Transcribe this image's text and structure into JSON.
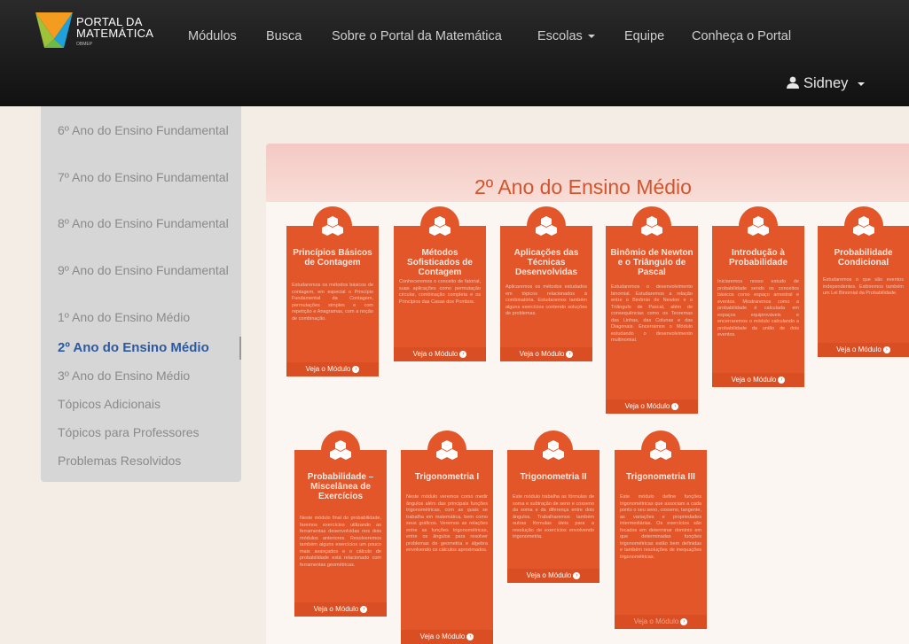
{
  "navbar": {
    "logo_line1": "PORTAL DA",
    "logo_line2": "MATEMÁTICA",
    "logo_sub": "OBMEP",
    "links": [
      "Módulos",
      "Busca",
      "Sobre o Portal da Matemática",
      "Escolas",
      "Equipe",
      "Conheça o Portal"
    ],
    "user": "Sidney"
  },
  "sidebar": {
    "items": [
      "6º Ano do Ensino Fundamental",
      "7º Ano do Ensino Fundamental",
      "8º Ano do Ensino Fundamental",
      "9º Ano do Ensino Fundamental",
      "1º Ano do Ensino Médio",
      "2º Ano do Ensino Médio",
      "3º Ano do Ensino Médio",
      "Tópicos Adicionais",
      "Tópicos para Professores",
      "Problemas Resolvidos"
    ],
    "active_index": 5
  },
  "main": {
    "heading": "2º Ano do Ensino Médio",
    "button_label": "Veja o Módulo",
    "cards": [
      {
        "title": "Princípios Básicos de Contagem",
        "desc": "Estudaremos os métodos básicos de contagem, em especial o Princípio Fundamental da Contagem, permutações simples e com repetição e Anagramas, com a noção de combinação."
      },
      {
        "title": "Métodos Sofisticados de Contagem",
        "desc": "Conheceremos o conceito de fatorial, suas aplicações como permutação circular, combinação completa e os Princípios das Casas dos Pombos."
      },
      {
        "title": "Aplicações das Técnicas Desenvolvidas",
        "desc": "Aplicaremos os métodos estudados em tópicos relacionados à combinatória. Estudaremos também alguns exercícios contendo soluções de problemas."
      },
      {
        "title": "Binômio de Newton e o Triângulo de Pascal",
        "desc": "Estudaremos o desenvolvimento binomial. Estudaremos a relação entre o Binômio de Newton e o Triângulo de Pascal, além de consequências como os Teoremas das Linhas, das Colunas e das Diagonais. Encerramos o Módulo estudando o desenvolvimento multinomial."
      },
      {
        "title": "Introdução à Probabilidade",
        "desc": "Iniciaremos nosso estudo de probabilidade sendo os conceitos básicos como espaço amostral e eventos. Mostraremos como a probabilidade é calculada em espaços equiprováveis e encerraremos o módulo calculando a probabilidade da união de dois eventos."
      },
      {
        "title": "Probabilidade Condicional",
        "desc": "Estudaremos o que são eventos independentes. Exibiremos também um Lei Binomial da Probabilidade."
      },
      {
        "title": "Probabilidade – Miscelânea de Exercícios",
        "desc": "Neste módulo final do probabilidade, faremos exercícios utilizando as ferramentas desenvolvidas nos dois módulos anteriores. Resolveremos também alguns exercícios um pouco mais avançados e o cálculo de probabilidade está relacionado com ferramentas geométricas."
      },
      {
        "title": "Trigonometria I",
        "desc": "Neste módulo veremos como medir ângulos além das principais funções trigonométricas, com as quais se trabalha em matemática, bem como seus gráficos. Veremos as relações entre as funções trigonométricas, entre os ângulos para resolver problemas de geometria e álgebra envolvendo os cálculos aproximados."
      },
      {
        "title": "Trigonometria II",
        "desc": "Este módulo trabalha as fórmulas de soma e subtração de seno e cosseno da soma e da diferença entre dois ângulos. Trabalharemos também outras fórmulas úteis para a resolução de exercícios envolvendo trigonometria."
      },
      {
        "title": "Trigonometria III",
        "desc": "Este módulo define funções trigonométricas que associam a cada ponto o seu seno, cosseno, tangente, as variações e propriedades intermediárias. Os exercícios são focados em determinar domínio em que determinadas funções trigonométricas estão bem definidas e também resoluções de inequações trigonométricas."
      }
    ]
  }
}
